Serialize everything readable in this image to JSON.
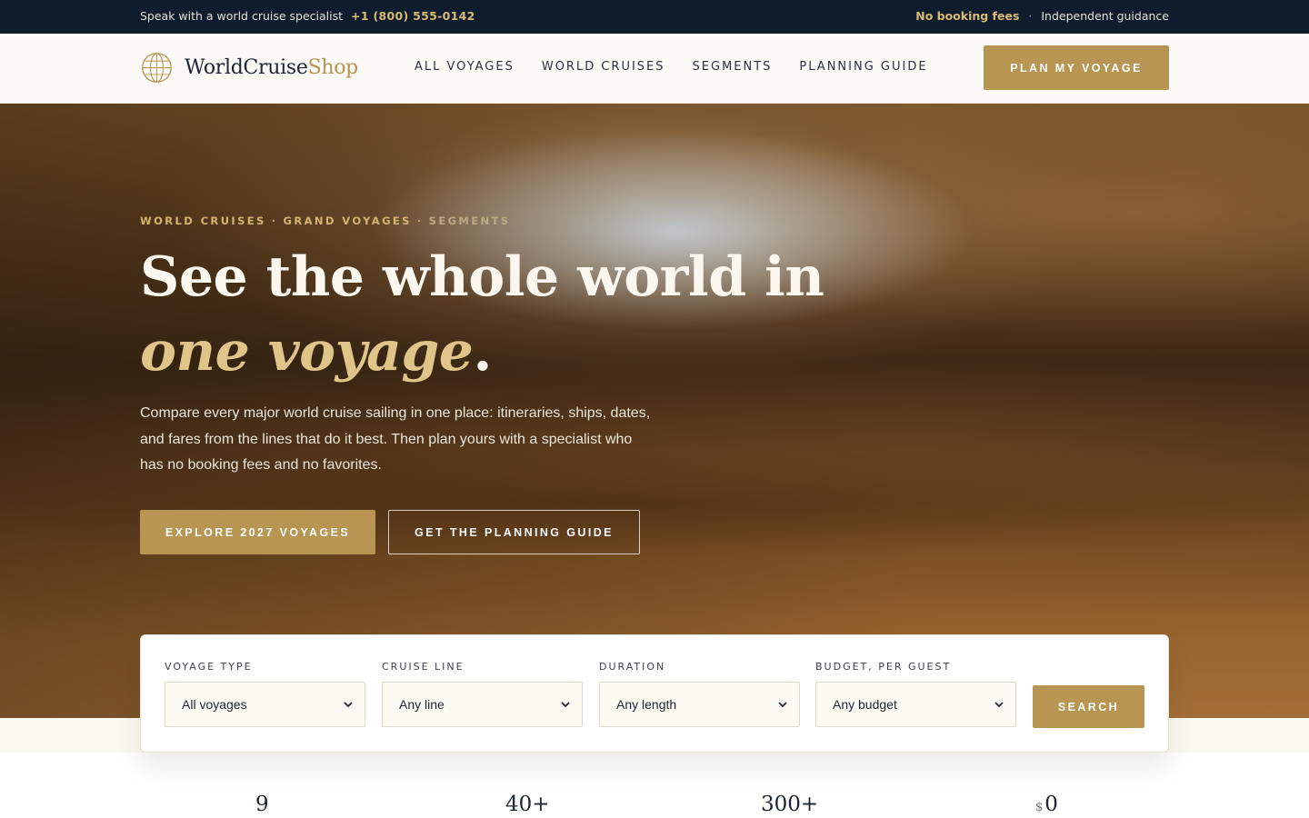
{
  "topbar": {
    "specialist_text": "Speak with a world cruise specialist",
    "phone": "+1 (800) 555-0142",
    "no_fees": "No booking fees",
    "separator": "·",
    "guidance": "Independent guidance"
  },
  "header": {
    "logo_main": "WorldCruise",
    "logo_accent": "Shop",
    "logo_icon": "globe-icon",
    "nav": [
      "ALL VOYAGES",
      "WORLD CRUISES",
      "SEGMENTS",
      "PLANNING GUIDE"
    ],
    "cta": "PLAN MY VOYAGE"
  },
  "hero": {
    "eyebrow": [
      "WORLD CRUISES",
      "GRAND VOYAGES",
      "SEGMENTS"
    ],
    "eyebrow_sep": "·",
    "headline_plain": "See the whole world in ",
    "headline_italic": "one voyage",
    "headline_end": ".",
    "intro": "Compare every major world cruise sailing in one place: itineraries, ships, dates, and fares from the lines that do it best. Then plan yours with a specialist who has no booking fees and no favorites.",
    "primary_cta": "EXPLORE 2027 VOYAGES",
    "secondary_cta": "GET THE PLANNING GUIDE"
  },
  "search": {
    "fields": [
      {
        "label": "VOYAGE TYPE",
        "value": "All voyages"
      },
      {
        "label": "CRUISE LINE",
        "value": "Any line"
      },
      {
        "label": "DURATION",
        "value": "Any length"
      },
      {
        "label": "BUDGET, PER GUEST",
        "value": "Any budget"
      }
    ],
    "button": "SEARCH"
  },
  "stats": [
    {
      "value": "9"
    },
    {
      "value": "40+"
    },
    {
      "value": "300+"
    },
    {
      "currency": "$",
      "value": "0"
    }
  ],
  "colors": {
    "navy": "#0f1c2e",
    "gold": "#b89553",
    "cream": "#fbfaf6",
    "headline_accent": "#e0c58a"
  }
}
